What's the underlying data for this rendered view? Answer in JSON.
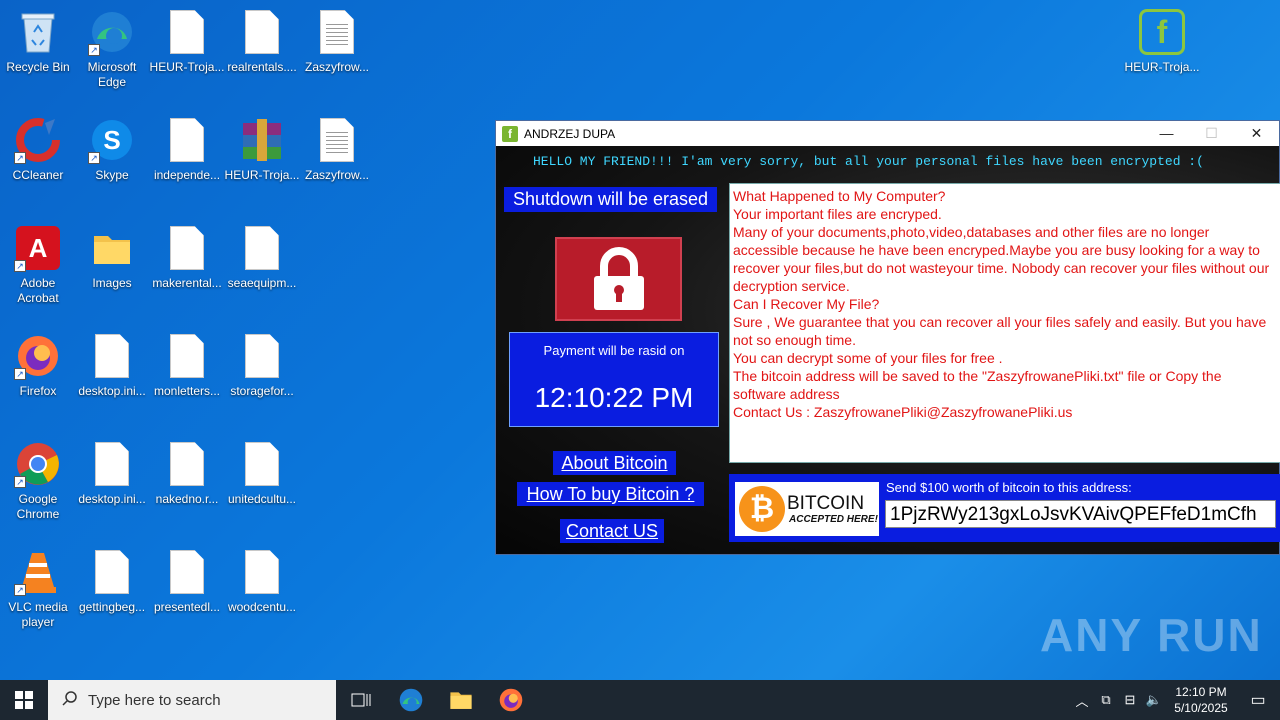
{
  "desktop": {
    "icons": [
      {
        "label": "Recycle Bin"
      },
      {
        "label": "Microsoft Edge"
      },
      {
        "label": "HEUR-Troja..."
      },
      {
        "label": "realrentals...."
      },
      {
        "label": "Zaszyfrow..."
      },
      {
        "label": "CCleaner"
      },
      {
        "label": "Skype"
      },
      {
        "label": "independe..."
      },
      {
        "label": "HEUR-Troja..."
      },
      {
        "label": "Zaszyfrow..."
      },
      {
        "label": "Adobe Acrobat"
      },
      {
        "label": "Images"
      },
      {
        "label": "makerental..."
      },
      {
        "label": "seaequipm..."
      },
      {
        "label": "Firefox"
      },
      {
        "label": "desktop.ini..."
      },
      {
        "label": "monletters..."
      },
      {
        "label": "storagefor..."
      },
      {
        "label": "Google Chrome"
      },
      {
        "label": "desktop.ini..."
      },
      {
        "label": "nakedno.r..."
      },
      {
        "label": "unitedcultu..."
      },
      {
        "label": "VLC media player"
      },
      {
        "label": "gettingbeg..."
      },
      {
        "label": "presentedl..."
      },
      {
        "label": "woodcentu..."
      },
      {
        "label": "HEUR-Troja..."
      }
    ]
  },
  "window": {
    "title": "ANDRZEJ DUPA",
    "hello": "HELLO MY FRIEND!!! I'am very sorry, but all your personal files have been encrypted :(",
    "shutdown": "Shutdown will be erased",
    "payment_label": "Payment will be rasid on",
    "payment_time": "12:10:22 PM",
    "links": {
      "about": "About  Bitcoin",
      "howto": "How To buy Bitcoin ?",
      "contact": "Contact US"
    },
    "message": [
      "What Happened to My Computer?",
      "Your important files are encryped.",
      "Many of your documents,photo,video,databases and other files are no longer accessible because he have been encryped.Maybe you are busy looking for a way to recover your files,but do not wasteyour time. Nobody can recover your files without our decryption service.",
      "Can I Recover My File?",
      "Sure , We guarantee that you can recover all your files safely and easily. But you have not so enough time.",
      "You can decrypt some of your files for free .",
      "The bitcoin address will be saved to the \"ZaszyfrowanePliki.txt\" file or Copy the software address",
      "Contact Us : ZaszyfrowanePliki@ZaszyfrowanePliki.us"
    ],
    "btc_logo_main": "BITCOIN",
    "btc_logo_sub": "ACCEPTED HERE!",
    "send_label": "Send $100 worth of bitcoin to this address:",
    "address": "1PjzRWy213gxLoJsvKVAivQPEFfeD1mCfh"
  },
  "taskbar": {
    "search_placeholder": "Type here to search",
    "time": "12:10 PM",
    "date": "5/10/2025"
  },
  "watermark": "ANY RUN",
  "colors": {
    "accent": "#0a1de0",
    "message": "#e11515",
    "hello": "#3fd7ff"
  }
}
